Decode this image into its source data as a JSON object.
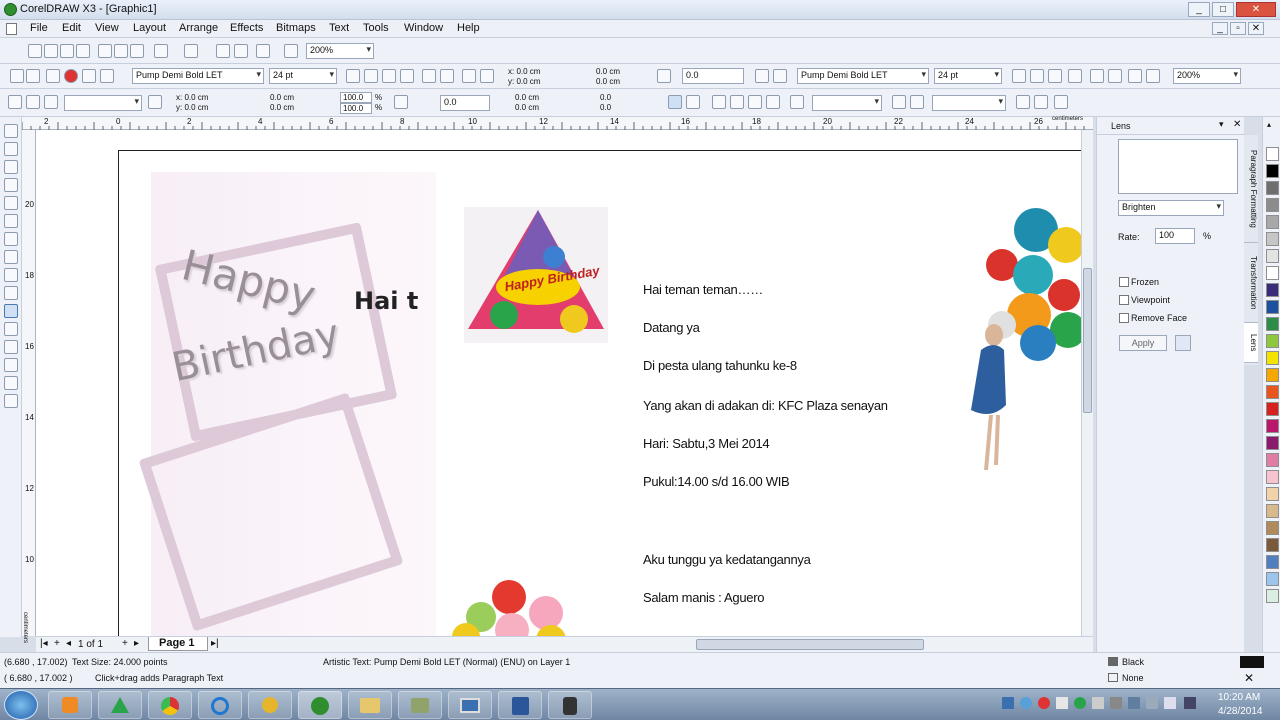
{
  "window": {
    "title": "CorelDRAW X3 - [Graphic1]",
    "min": "_",
    "max": "□",
    "close": "✕",
    "doc_min": "_",
    "doc_max": "▫",
    "doc_close": "✕"
  },
  "menu": [
    "File",
    "Edit",
    "View",
    "Layout",
    "Arrange",
    "Effects",
    "Bitmaps",
    "Text",
    "Tools",
    "Window",
    "Help"
  ],
  "toolbar1": {
    "zoom": "200%"
  },
  "toolbar2": {
    "font": "Pump Demi Bold LET",
    "size": "24 pt",
    "x": "x: 0.0 cm",
    "y": "y: 0.0 cm",
    "w": "0.0 cm",
    "h": "0.0 cm",
    "angle": "0.0",
    "font2": "Pump Demi Bold LET",
    "size2": "24 pt",
    "zoom2": "200%"
  },
  "toolbar3": {
    "x": "x: 0.0 cm",
    "y": "y: 0.0 cm",
    "w": "0.0 cm",
    "h": "0.0 cm",
    "scale_w": "100.0",
    "scale_h": "100.0",
    "pct": "%",
    "pct2": "%",
    "angle": "0.0",
    "ox": "0.0 cm",
    "oy": "0.0 cm",
    "pos1": "0.0",
    "pos2": "0.0"
  },
  "ruler": {
    "unit": "centimeters",
    "unit_v": "centimeters",
    "h_ticks": [
      "2",
      "0",
      "2",
      "4",
      "6",
      "8",
      "10",
      "12",
      "14",
      "16",
      "18",
      "20",
      "22",
      "24",
      "26"
    ],
    "v_ticks": [
      "20",
      "18",
      "16",
      "14",
      "12",
      "10"
    ]
  },
  "canvas": {
    "happy": "Happy",
    "birthday": "Birthday",
    "hai": "Hai t",
    "hat_text": "Happy Birthday",
    "lines": [
      "Hai teman teman……",
      "Datang ya",
      "Di pesta ulang tahunku ke-8",
      "Yang akan di adakan di: KFC Plaza senayan",
      "Hari: Sabtu,3 Mei 2014",
      "Pukul:14.00 s/d 16.00 WIB",
      "Aku tunggu ya kedatangannya",
      "Salam manis : Aguero"
    ]
  },
  "pagenav": {
    "count": "1 of 1",
    "page_tab": "Page 1",
    "first": "|◂",
    "prev": "◂",
    "next": "▸",
    "last": "▸|",
    "add": "+",
    "add2": "+"
  },
  "docker": {
    "title": "Lens",
    "effect": "Brighten",
    "rate_label": "Rate:",
    "rate_value": "100",
    "rate_unit": "%",
    "frozen": "Frozen",
    "viewpoint": "Viewpoint",
    "remove_face": "Remove Face",
    "apply": "Apply"
  },
  "docker_tabs": [
    "Paragraph Formatting",
    "Transformation",
    "Lens"
  ],
  "palette": [
    "#ffffff",
    "#000000",
    "#6e6e6e",
    "#8c8c8c",
    "#a8a8a8",
    "#c6c6c6",
    "#e3e3e3",
    "#ffffff",
    "#3a2b7a",
    "#1e50a0",
    "#2d8c46",
    "#8ec63f",
    "#f2e400",
    "#f7a800",
    "#e8561e",
    "#d6211f",
    "#b8176b",
    "#8a1a6b",
    "#e07ca6",
    "#f6c3cf",
    "#f2d2a8",
    "#d8b98b",
    "#b08a5a",
    "#7a5a3a",
    "#4f7fbf",
    "#9bc5ea",
    "#d9efe2"
  ],
  "status": {
    "coords": "(6.680 , 17.002)",
    "text_size": "Text Size: 24.000 points",
    "object": "Artistic Text: Pump Demi Bold LET (Normal) (ENU) on Layer 1",
    "coords2": "( 6.680 , 17.002 )",
    "hint": "Click+drag adds Paragraph Text",
    "fill": "Black",
    "outline": "None"
  },
  "taskbar": {
    "time": "10:20 AM",
    "date": "4/28/2014"
  },
  "colors": {
    "accent": "#1e5aa8"
  }
}
